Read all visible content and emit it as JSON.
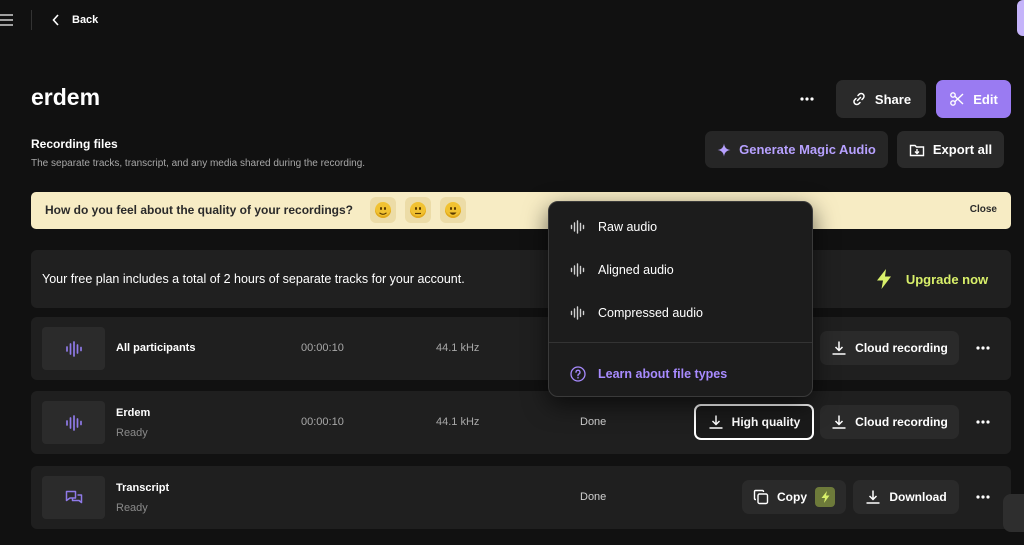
{
  "nav": {
    "back_label": "Back"
  },
  "page": {
    "title": "erdem"
  },
  "header_actions": {
    "share_label": "Share",
    "edit_label": "Edit"
  },
  "recording_files": {
    "title": "Recording files",
    "subtitle": "The separate tracks, transcript, and any media shared during the recording.",
    "magic_audio_label": "Generate Magic Audio",
    "export_all_label": "Export all"
  },
  "feedback_banner": {
    "question": "How do you feel about the quality of your recordings?",
    "options": [
      "slightly-smiling-face",
      "neutral-face",
      "grinning-face"
    ],
    "close_label": "Close"
  },
  "plan_notice": {
    "text": "Your free plan includes a total of 2 hours of separate tracks for your account.",
    "upgrade_label": "Upgrade now"
  },
  "rows": [
    {
      "name": "All participants",
      "duration": "00:00:10",
      "sample_rate": "44.1 kHz",
      "cloud_label": "Cloud recording"
    },
    {
      "name": "Erdem",
      "sub": "Ready",
      "duration": "00:00:10",
      "sample_rate": "44.1 kHz",
      "status": "Done",
      "quality_label": "High quality",
      "cloud_label": "Cloud recording"
    },
    {
      "name": "Transcript",
      "sub": "Ready",
      "status": "Done",
      "copy_label": "Copy",
      "download_label": "Download"
    }
  ],
  "download_menu": {
    "items": [
      "Raw audio",
      "Aligned audio",
      "Compressed audio"
    ],
    "learn_link": "Learn about file types"
  },
  "colors": {
    "accent_purple": "#9a7bf2",
    "upgrade_lime": "#d9f06a",
    "banner_bg": "#f7ecc4"
  }
}
